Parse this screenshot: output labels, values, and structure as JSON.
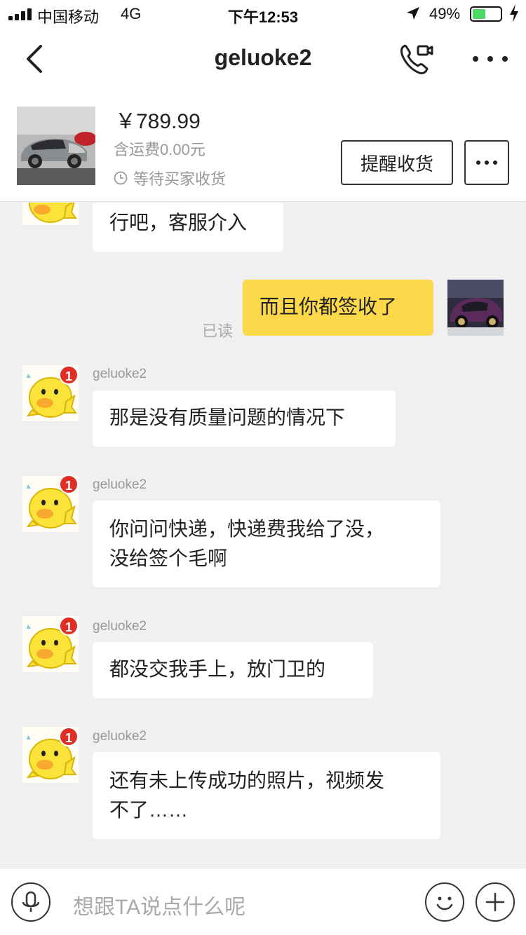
{
  "status_bar": {
    "carrier": "中国移动",
    "network": "4G",
    "time": "下午12:53",
    "battery": "49%",
    "battery_level": 0.49
  },
  "nav": {
    "title": "geluoke2",
    "back_icon": "chevron-left-icon",
    "call_icon": "phone-video-icon",
    "more_icon": "more-dots-icon"
  },
  "product": {
    "price": "￥789.99",
    "shipping": "含运费0.00元",
    "status": "等待买家收货",
    "remind_label": "提醒收货"
  },
  "messages": [
    {
      "from": "other",
      "text": "行吧，客服介入"
    },
    {
      "from": "me",
      "text": "而且你都签收了",
      "read": "已读"
    },
    {
      "from": "other",
      "sender": "geluoke2",
      "badge": "1",
      "text": "那是没有质量问题的情况下"
    },
    {
      "from": "other",
      "sender": "geluoke2",
      "badge": "1",
      "lines": [
        "你问问快递，快递费我给了没，",
        "没给签个毛啊"
      ]
    },
    {
      "from": "other",
      "sender": "geluoke2",
      "badge": "1",
      "text": "都没交我手上，放门卫的"
    },
    {
      "from": "other",
      "sender": "geluoke2",
      "badge": "1",
      "lines": [
        "还有未上传成功的照片，视频发",
        "不了……"
      ]
    }
  ],
  "input": {
    "placeholder": "想跟TA说点什么呢"
  }
}
